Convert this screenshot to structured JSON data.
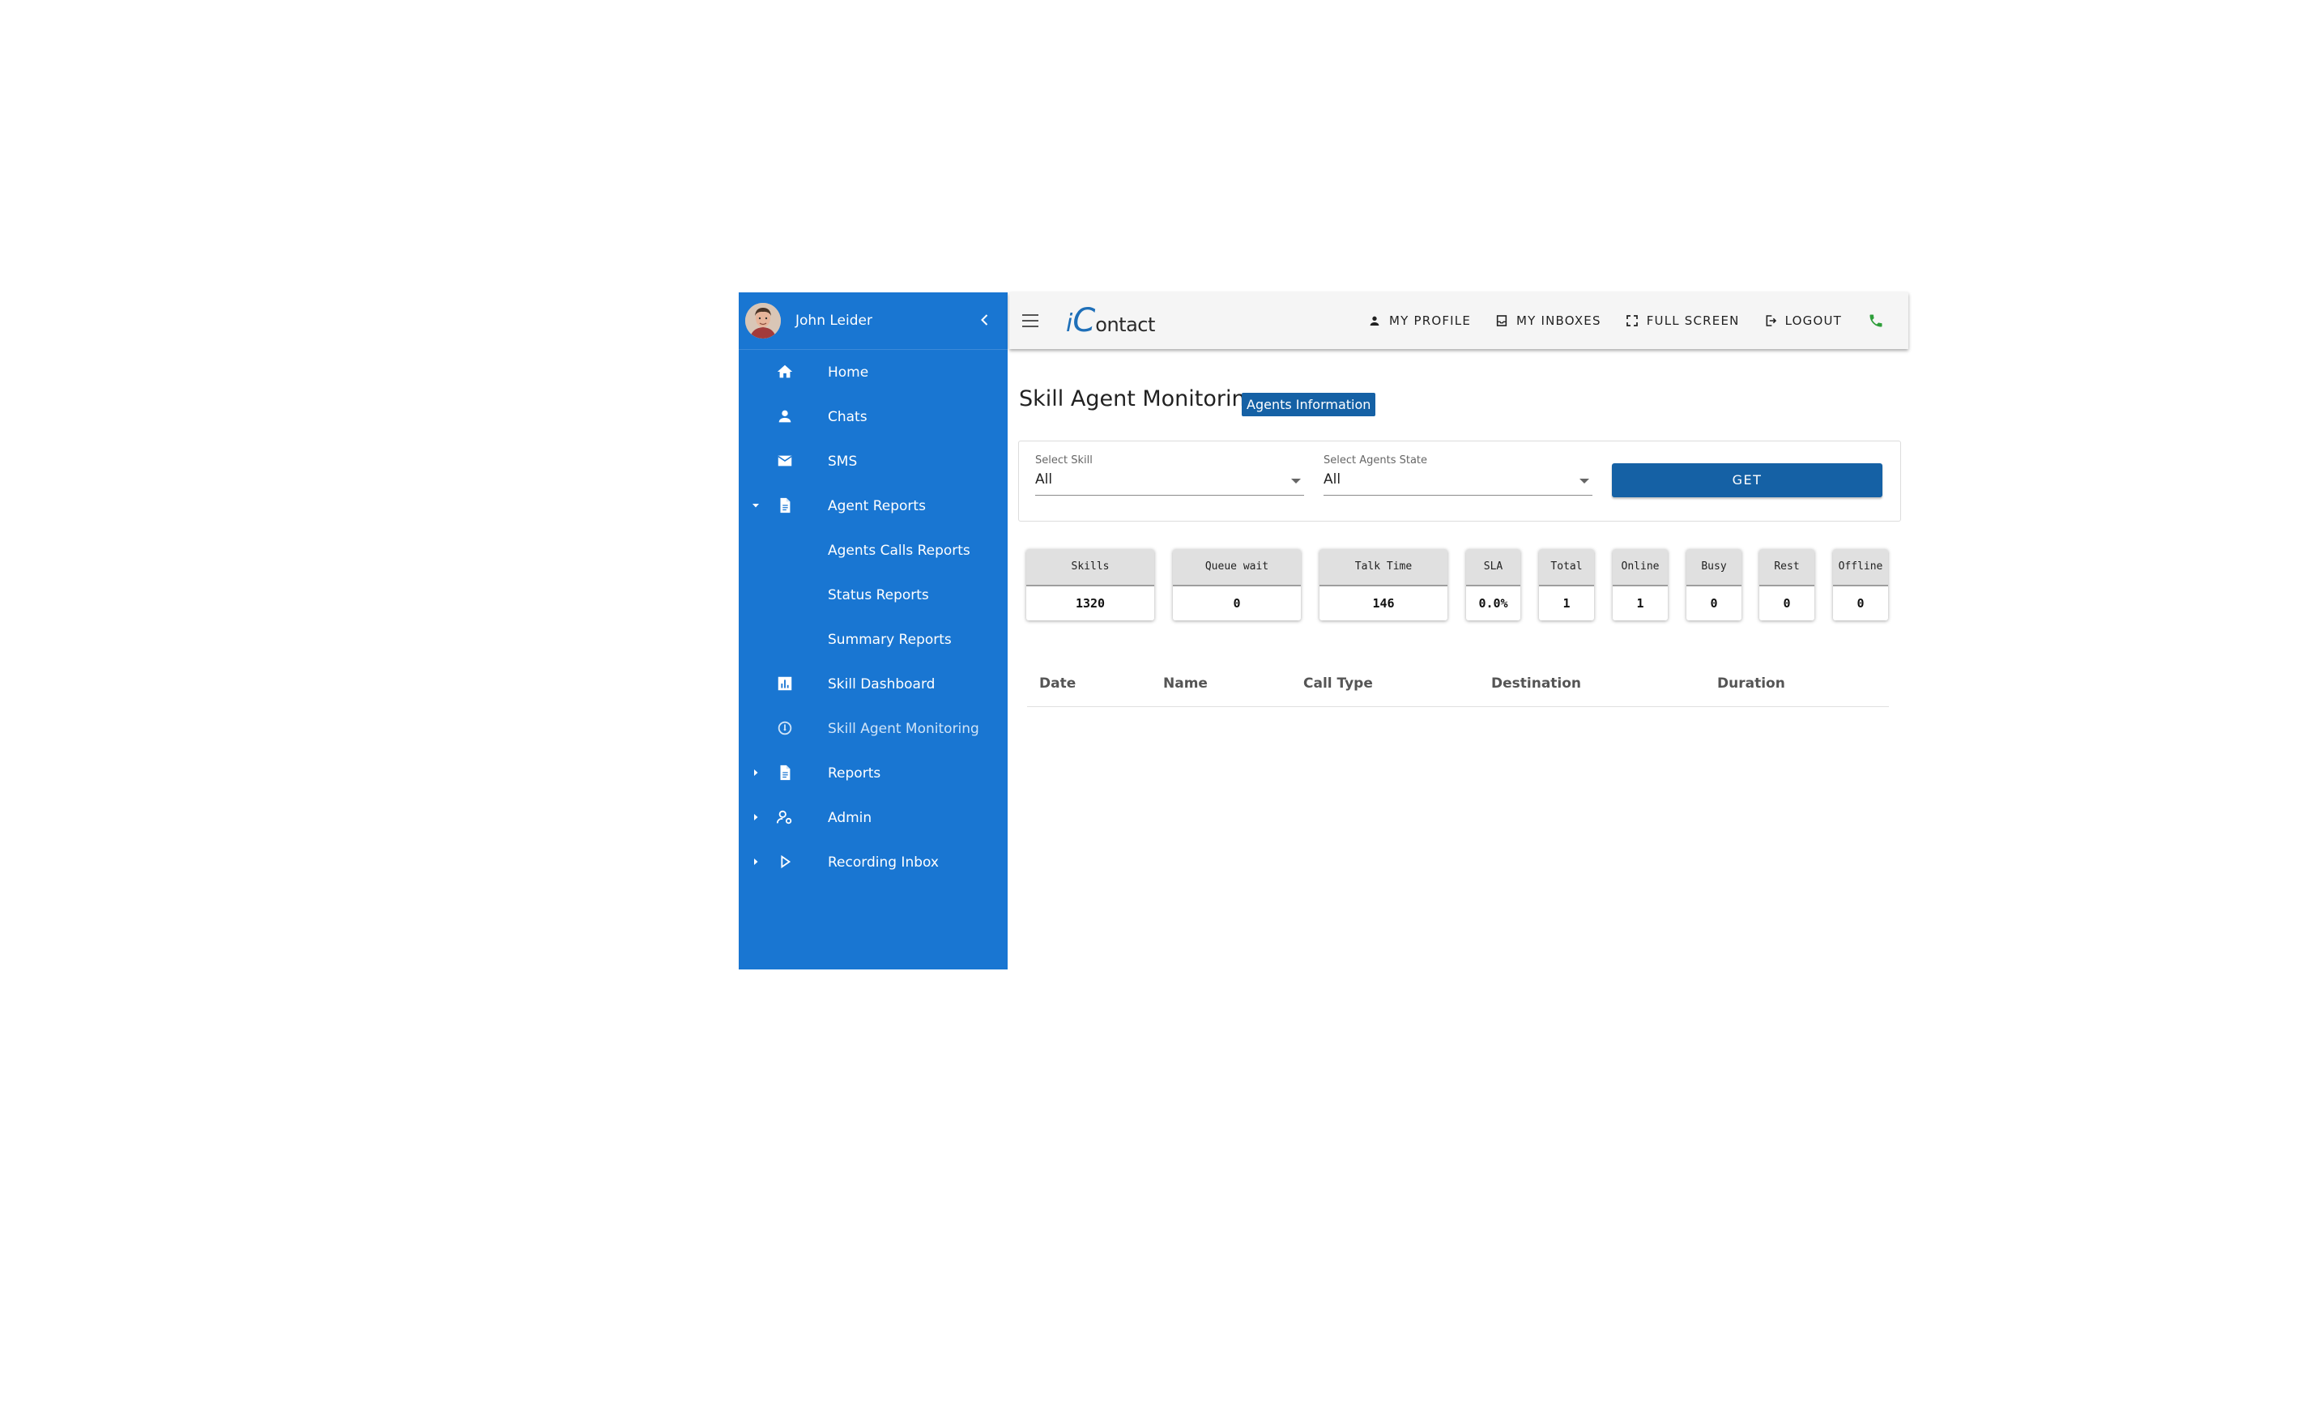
{
  "sidebar": {
    "user_name": "John Leider",
    "items": [
      {
        "label": "Home"
      },
      {
        "label": "Chats"
      },
      {
        "label": "SMS"
      },
      {
        "label": "Agent Reports"
      },
      {
        "label": "Agents Calls Reports"
      },
      {
        "label": "Status Reports"
      },
      {
        "label": "Summary Reports"
      },
      {
        "label": "Skill Dashboard"
      },
      {
        "label": "Skill Agent Monitoring"
      },
      {
        "label": "Reports"
      },
      {
        "label": "Admin"
      },
      {
        "label": "Recording Inbox"
      }
    ]
  },
  "topbar": {
    "logo_i": "i",
    "logo_c": "C",
    "logo_rest": "ontact",
    "my_profile": "MY PROFILE",
    "my_inboxes": "MY INBOXES",
    "full_screen": "FULL SCREEN",
    "logout": "LOGOUT"
  },
  "page": {
    "title": "Skill Agent Monitoring",
    "badge": "Agents Information"
  },
  "filters": {
    "skill_label": "Select Skill",
    "skill_value": "All",
    "state_label": "Select Agents State",
    "state_value": "All",
    "get_label": "GET"
  },
  "stats": [
    {
      "label": "Skills",
      "value": "1320"
    },
    {
      "label": "Queue wait",
      "value": "0"
    },
    {
      "label": "Talk Time",
      "value": "146"
    },
    {
      "label": "SLA",
      "value": "0.0%"
    },
    {
      "label": "Total",
      "value": "1"
    },
    {
      "label": "Online",
      "value": "1"
    },
    {
      "label": "Busy",
      "value": "0"
    },
    {
      "label": "Rest",
      "value": "0"
    },
    {
      "label": "Offline",
      "value": "0"
    }
  ],
  "table": {
    "columns": [
      "Date",
      "Name",
      "Call Type",
      "Destination",
      "Duration"
    ]
  },
  "colors": {
    "sidebar_bg": "#1976d2",
    "primary_button": "#1561a5",
    "phone_icon": "#2e9e3a"
  }
}
